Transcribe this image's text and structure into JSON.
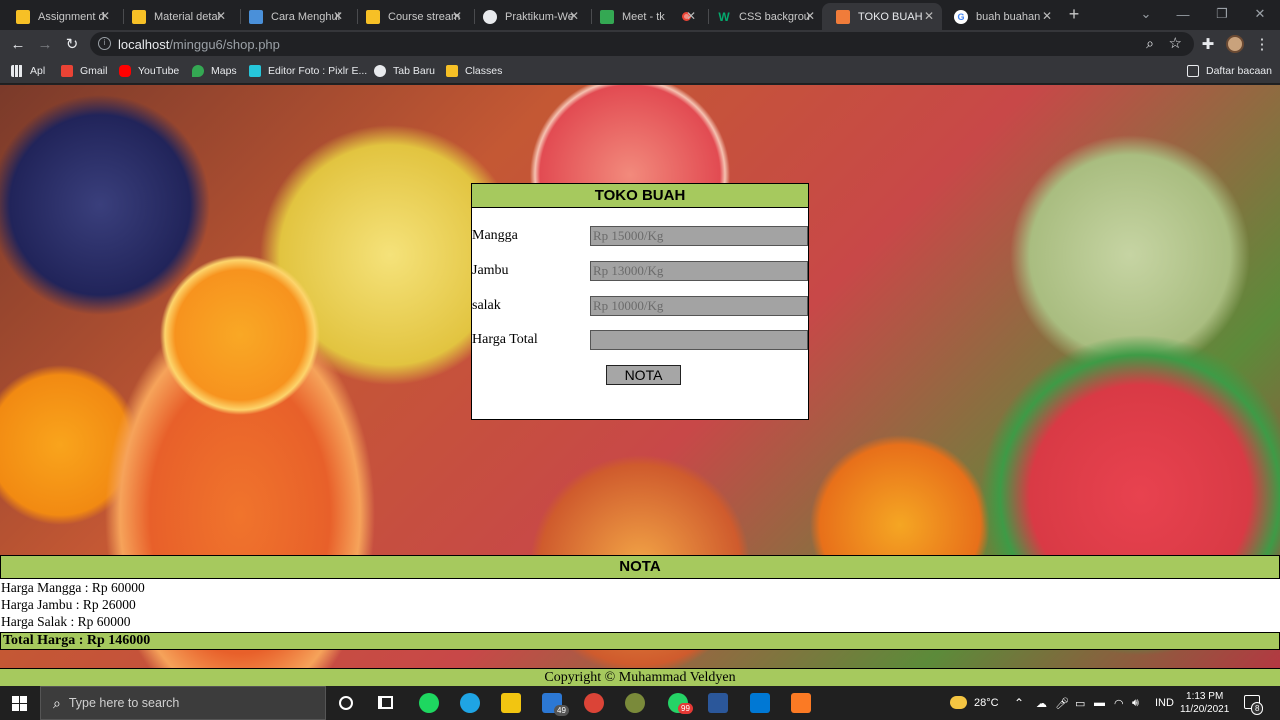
{
  "browser": {
    "tabs": [
      {
        "title": "Assignment d",
        "favicon_color": "#f6c026"
      },
      {
        "title": "Material detai",
        "favicon_color": "#f6c026"
      },
      {
        "title": "Cara Menghul",
        "favicon_color": "#4a90d9"
      },
      {
        "title": "Course stream",
        "favicon_color": "#f6c026"
      },
      {
        "title": "Praktikum-We",
        "favicon_color": "#e8eaed"
      },
      {
        "title": "Meet - tk",
        "favicon_color": "#34a853"
      },
      {
        "title": "CSS backgrou",
        "favicon_color": "#04aa6d"
      },
      {
        "title": "TOKO BUAH",
        "favicon_color": "#f07c3a"
      },
      {
        "title": "buah buahan",
        "favicon_color": "#4285f4"
      }
    ],
    "new_tab": "+",
    "url_host": "localhost",
    "url_path": "/minggu6/shop.php",
    "bookmarks": [
      {
        "label": "Apl",
        "color": "#e8eaed"
      },
      {
        "label": "Gmail",
        "color": "#ea4335"
      },
      {
        "label": "YouTube",
        "color": "#ff0000"
      },
      {
        "label": "Maps",
        "color": "#34a853"
      },
      {
        "label": "Editor Foto : Pixlr E...",
        "color": "#26c6da"
      },
      {
        "label": "Tab Baru",
        "color": "#e8eaed"
      },
      {
        "label": "Classes",
        "color": "#f6c026"
      }
    ],
    "reading_list": "Daftar bacaan"
  },
  "shop": {
    "title": "TOKO BUAH",
    "fields": [
      {
        "label": "Mangga",
        "placeholder": "Rp 15000/Kg"
      },
      {
        "label": "Jambu",
        "placeholder": "Rp 13000/Kg"
      },
      {
        "label": "salak",
        "placeholder": "Rp 10000/Kg"
      },
      {
        "label": "Harga Total",
        "placeholder": ""
      }
    ],
    "button": "NOTA"
  },
  "nota": {
    "title": "NOTA",
    "lines": [
      "Harga Mangga : Rp 60000",
      "Harga Jambu : Rp 26000",
      "Harga Salak : Rp 60000"
    ],
    "total": "Total Harga : Rp 146000"
  },
  "footer": "Copyright © Muhammad Veldyen",
  "taskbar": {
    "search_placeholder": "Type here to search",
    "mail_badge": "49",
    "whatsapp_badge": "99",
    "temperature": "28°C",
    "language": "IND",
    "time": "1:13 PM",
    "date": "11/20/2021",
    "notifications": "8"
  }
}
